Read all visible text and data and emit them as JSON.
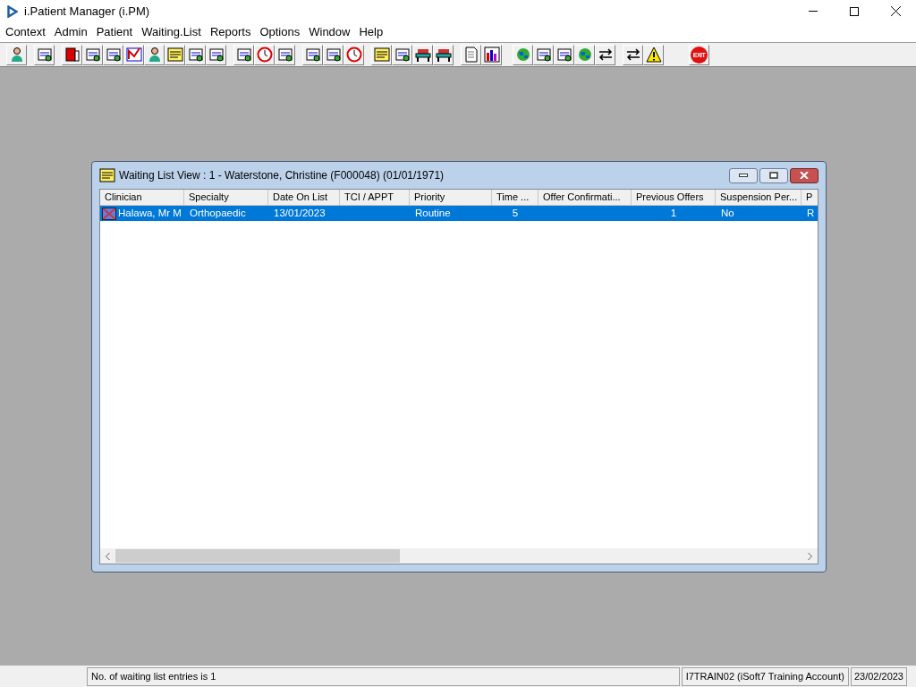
{
  "window": {
    "title": "i.Patient Manager (i.PM)"
  },
  "menu": [
    "Context",
    "Admin",
    "Patient",
    "Waiting.List",
    "Reports",
    "Options",
    "Window",
    "Help"
  ],
  "toolbar": {
    "exit_label": "EXIT"
  },
  "child_window": {
    "title": "Waiting List View :  1 - Waterstone, Christine (F000048) (01/01/1971)",
    "columns": [
      "Clinician",
      "Specialty",
      "Date On List",
      "TCI / APPT",
      "Priority",
      "Time ...",
      "Offer Confirmati...",
      "Previous Offers",
      "Suspension Per...",
      "P"
    ],
    "rows": [
      {
        "selected": true,
        "cells": [
          "Halawa, Mr M",
          "Orthopaedic",
          "13/01/2023",
          "",
          "Routine",
          "5",
          "",
          "1",
          "No",
          "R"
        ]
      }
    ]
  },
  "status_bar": [
    "No. of waiting list entries is 1",
    "I7TRAIN02 (iSoft7 Training Account)",
    "23/02/2023"
  ]
}
